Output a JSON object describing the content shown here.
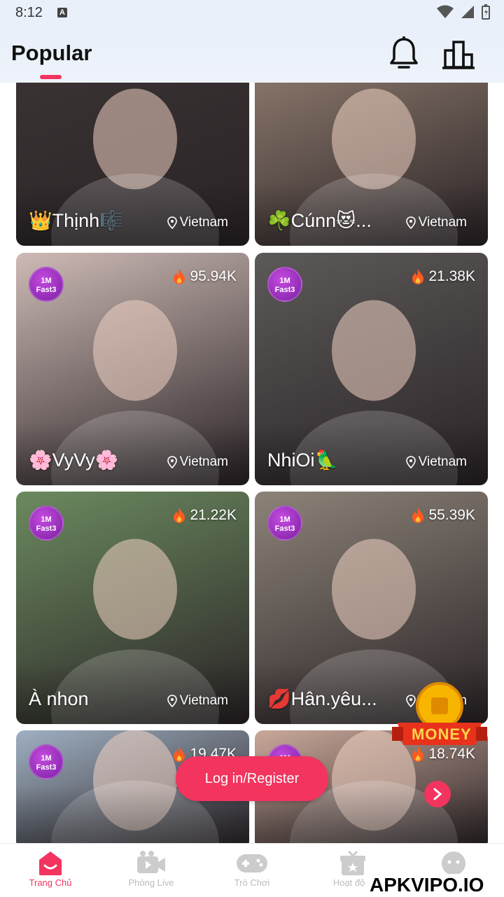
{
  "status_bar": {
    "time": "8:12",
    "notification_glyph": "A"
  },
  "header": {
    "active_tab": "Popular",
    "accent_color": "#f2345f"
  },
  "cards": [
    {
      "name": "👑Thịnh🎼",
      "location": "Vietnam",
      "views": "",
      "badge": "",
      "bg": "#3a3434"
    },
    {
      "name": "☘️Cúnn😻...",
      "location": "Vietnam",
      "views": "",
      "badge": "",
      "bg": "#8d7a6d"
    },
    {
      "name": "🌸VyVy🌸",
      "location": "Vietnam",
      "views": "95.94K",
      "badge": "1M Fast3",
      "bg": "#cdbab5"
    },
    {
      "name": "NhiOi🦜",
      "location": "Vietnam",
      "views": "21.38K",
      "badge": "1M Fast3",
      "bg": "#5c5a58"
    },
    {
      "name": "À nhon",
      "location": "Vietnam",
      "views": "21.22K",
      "badge": "1M Fast3",
      "bg": "#6b8a5f"
    },
    {
      "name": "💋Hân.yêu...",
      "location": "Vietnam",
      "views": "55.39K",
      "badge": "1M Fast3",
      "bg": "#8c8378"
    },
    {
      "name": "",
      "location": "",
      "views": "19.47K",
      "badge": "1M Fast3",
      "bg": "#9fb0c2"
    },
    {
      "name": "",
      "location": "",
      "views": "18.74K",
      "badge": "1M Fast3",
      "bg": "#c9a89a"
    }
  ],
  "login_button": "Log in/Register",
  "money_label": "MONEY",
  "bottom_nav": [
    {
      "label": "Trang Chủ",
      "icon": "home-icon",
      "active": true
    },
    {
      "label": "Phòng Live",
      "icon": "video-icon",
      "active": false
    },
    {
      "label": "Trò Chơi",
      "icon": "gamepad-icon",
      "active": false
    },
    {
      "label": "Hoạt độ...",
      "icon": "gift-icon",
      "active": false
    },
    {
      "label": "",
      "icon": "profile-icon",
      "active": false
    }
  ],
  "watermark": "APKVIPO.IO"
}
